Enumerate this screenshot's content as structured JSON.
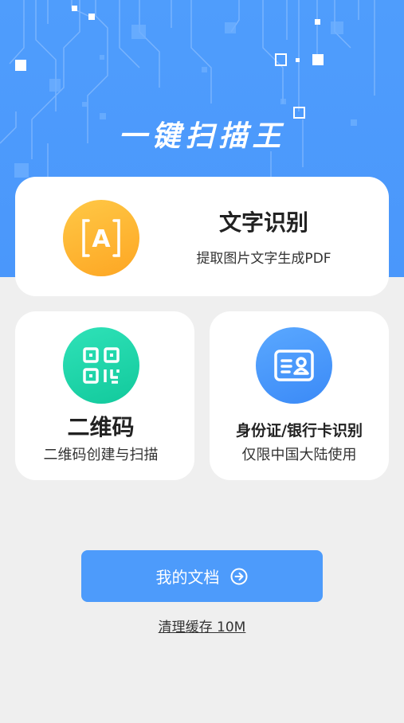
{
  "app_title": "一键扫描王",
  "colors": {
    "hero_blue": "#4f9dfc",
    "button_blue": "#4d9bfb",
    "ocr_orange": "#fdb534",
    "qr_green": "#1fd3a8",
    "id_blue": "#4a96fa",
    "background": "#efefef"
  },
  "features": {
    "ocr": {
      "icon": "text-recognition-icon",
      "icon_letter": "A",
      "title": "文字识别",
      "subtitle": "提取图片文字生成PDF"
    },
    "qrcode": {
      "icon": "qr-code-icon",
      "title": "二维码",
      "subtitle": "二维码创建与扫描"
    },
    "idcard": {
      "icon": "id-card-icon",
      "title": "身份证/银行卡识别",
      "subtitle": "仅限中国大陆使用"
    }
  },
  "my_documents": {
    "label": "我的文档",
    "icon": "arrow-right-circle-icon"
  },
  "clear_cache": {
    "label": "清理缓存 10M"
  }
}
